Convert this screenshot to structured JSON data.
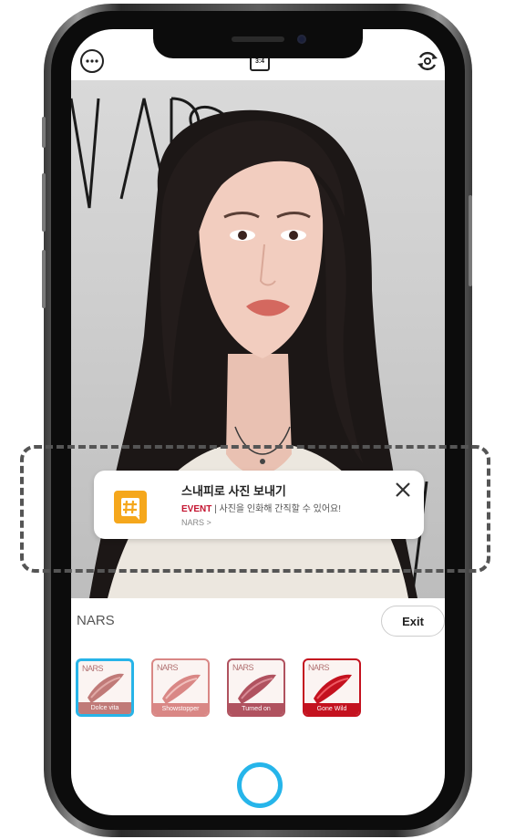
{
  "top_bar": {
    "more_icon": "more-dots-icon",
    "ratio_label": "3:4",
    "flip_icon": "camera-flip-icon"
  },
  "backdrop": {
    "logo_text": "NARS"
  },
  "notification": {
    "title": "스내피로 사진 보내기",
    "tag": "EVENT",
    "separator": " | ",
    "message": "사진을 인화해 간직할 수 있어요!",
    "source": "NARS >",
    "icon": "hashtag-icon",
    "accent_color": "#f5a71c"
  },
  "brand_label": "NARS",
  "exit_label": "Exit",
  "swatches": [
    {
      "brand": "NARS",
      "label": "Dolce vita",
      "color": "#c07a78",
      "selected": true
    },
    {
      "brand": "NARS",
      "label": "Showstopper",
      "color": "#d98785",
      "selected": false
    },
    {
      "brand": "NARS",
      "label": "Turned on",
      "color": "#b0525f",
      "selected": false
    },
    {
      "brand": "NARS",
      "label": "Gone Wild",
      "color": "#c4121f",
      "selected": false
    }
  ],
  "colors": {
    "accent": "#27b4e8",
    "event_red": "#c3132f"
  }
}
